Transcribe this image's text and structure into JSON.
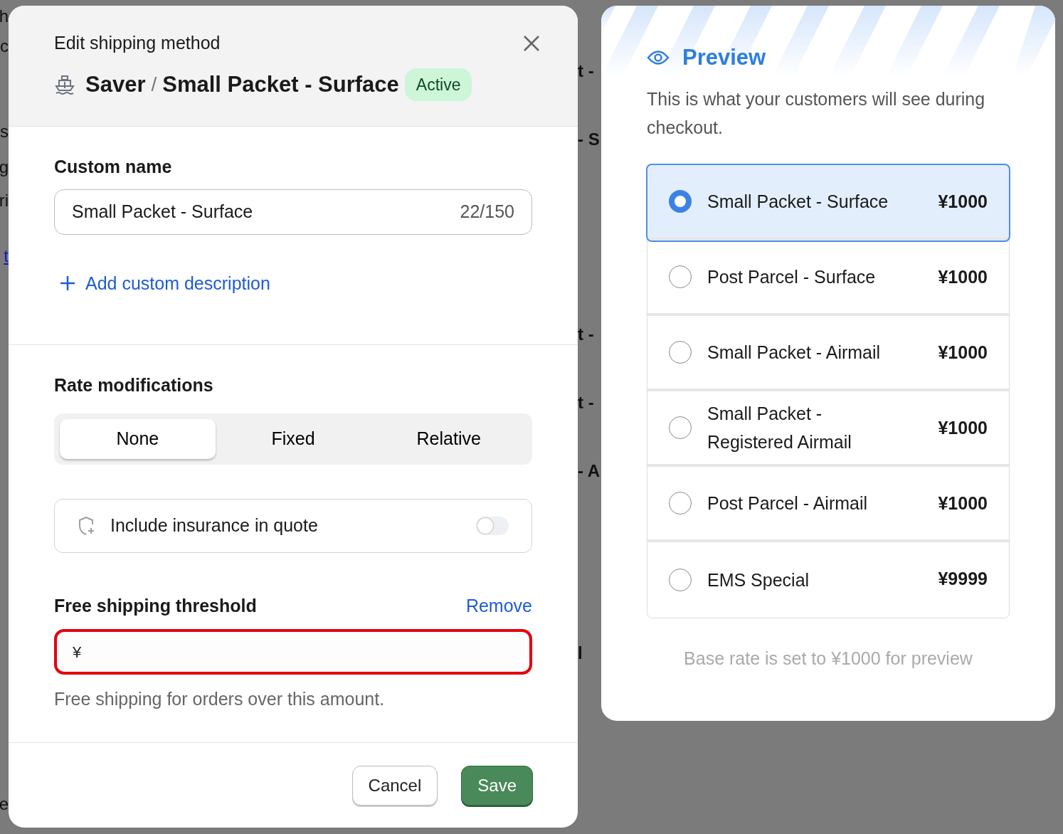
{
  "background_fragments": {
    "left": [
      {
        "text": "h",
        "kind": "text"
      },
      {
        "text": "c",
        "kind": "text"
      },
      {
        "text": "s",
        "kind": "text"
      },
      {
        "text": "g",
        "kind": "text"
      },
      {
        "text": "ri",
        "kind": "text"
      },
      {
        "text": "t",
        "kind": "link"
      },
      {
        "text": "e",
        "kind": "text"
      }
    ],
    "middle": [
      {
        "text": "t -",
        "kind": "text"
      },
      {
        "text": "- S",
        "kind": "text"
      },
      {
        "text": "t -",
        "kind": "text"
      },
      {
        "text": "t -",
        "kind": "text"
      },
      {
        "text": "- A",
        "kind": "text"
      },
      {
        "text": "l",
        "kind": "text"
      }
    ]
  },
  "dialog": {
    "subtitle": "Edit shipping method",
    "breadcrumb_parent": "Saver",
    "separator": "/",
    "title": "Small Packet - Surface",
    "status": "Active",
    "custom_name": {
      "label": "Custom name",
      "value": "Small Packet - Surface",
      "counter": "22/150"
    },
    "add_description": "Add custom description",
    "rate_modifications": {
      "label": "Rate modifications",
      "options": [
        {
          "label": "None",
          "selected": true
        },
        {
          "label": "Fixed",
          "selected": false
        },
        {
          "label": "Relative",
          "selected": false
        }
      ]
    },
    "insurance": {
      "label": "Include insurance in quote",
      "on": false
    },
    "free_shipping": {
      "label": "Free shipping threshold",
      "remove": "Remove",
      "prefix": "¥",
      "invalid": true,
      "help": "Free shipping for orders over this amount."
    },
    "buttons": [
      {
        "label": "Cancel",
        "kind": "secondary"
      },
      {
        "label": "Save",
        "kind": "primary"
      }
    ]
  },
  "preview": {
    "title": "Preview",
    "description": "This is what your customers will see during checkout.",
    "options": [
      {
        "name": "Small Packet - Surface",
        "price": "¥1000",
        "selected": true
      },
      {
        "name": "Post Parcel - Surface",
        "price": "¥1000",
        "selected": false
      },
      {
        "name": "Small Packet - Airmail",
        "price": "¥1000",
        "selected": false
      },
      {
        "name": "Small Packet - Registered Airmail",
        "price": "¥1000",
        "selected": false
      },
      {
        "name": "Post Parcel - Airmail",
        "price": "¥1000",
        "selected": false
      },
      {
        "name": "EMS Special",
        "price": "¥9999",
        "selected": false
      }
    ],
    "note": "Base rate is set to ¥1000 for preview"
  }
}
